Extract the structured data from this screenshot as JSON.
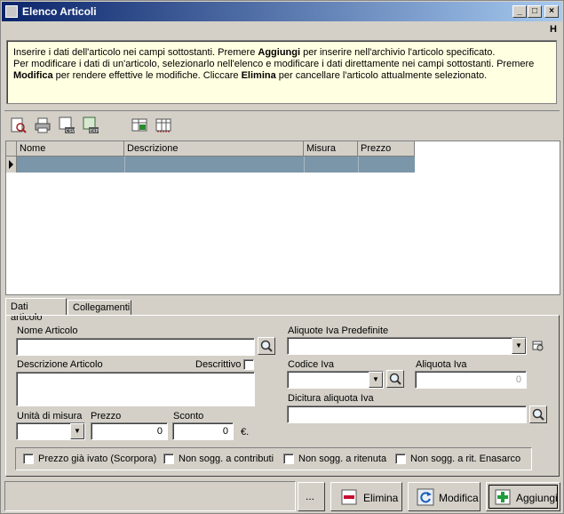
{
  "window": {
    "title": "Elenco Articoli",
    "hint_letter": "H"
  },
  "info": {
    "line1_pre": "Inserire i dati dell'articolo nei campi sottostanti. Premere ",
    "line1_bold": "Aggiungi",
    "line1_post": " per inserire nell'archivio l'articolo specificato.",
    "line2": "Per modificare i dati di un'articolo, selezionarlo nell'elenco e modificare i dati direttamente nei campi sottostanti. Premere",
    "line3_bold1": "Modifica",
    "line3_mid": " per rendere effettive le modifiche. Cliccare ",
    "line3_bold2": "Elimina",
    "line3_post": " per cancellare l'articolo attualmente selezionato."
  },
  "toolbar": {
    "icons": [
      "search-doc-icon",
      "print-icon",
      "csv-export-icon",
      "exp-export-icon",
      "add-column-icon",
      "columns-icon"
    ],
    "csv_label": "CSV",
    "exp_label": "EXP"
  },
  "grid": {
    "columns": [
      "Nome",
      "Descrizione",
      "Misura",
      "Prezzo"
    ]
  },
  "tabs": [
    "Dati articolo",
    "Collegamenti"
  ],
  "form": {
    "nome_label": "Nome Articolo",
    "nome_value": "",
    "descrizione_label": "Descrizione Articolo",
    "descrittivo_label": "Descrittivo",
    "unita_label": "Unità di misura",
    "prezzo_label": "Prezzo",
    "prezzo_value": "0",
    "sconto_label": "Sconto",
    "sconto_value": "0",
    "currency": "€.",
    "aliquote_label": "Aliquote Iva Predefinite",
    "codice_iva_label": "Codice Iva",
    "aliquota_label": "Aliquota Iva",
    "aliquota_value": "0",
    "dicitura_label": "Dicitura aliquota Iva"
  },
  "checkboxes": [
    "Prezzo già ivato (Scorpora)",
    "Non sogg. a contributi",
    "Non sogg. a ritenuta",
    "Non sogg. a rit. Enasarco"
  ],
  "buttons": {
    "more": "...",
    "elimina": "Elimina",
    "modifica": "Modifica",
    "aggiungi": "Aggiungi"
  },
  "colors": {
    "info_bg": "#ffffe1",
    "selected_row": "#7a96a8",
    "title_start": "#0a246a"
  }
}
